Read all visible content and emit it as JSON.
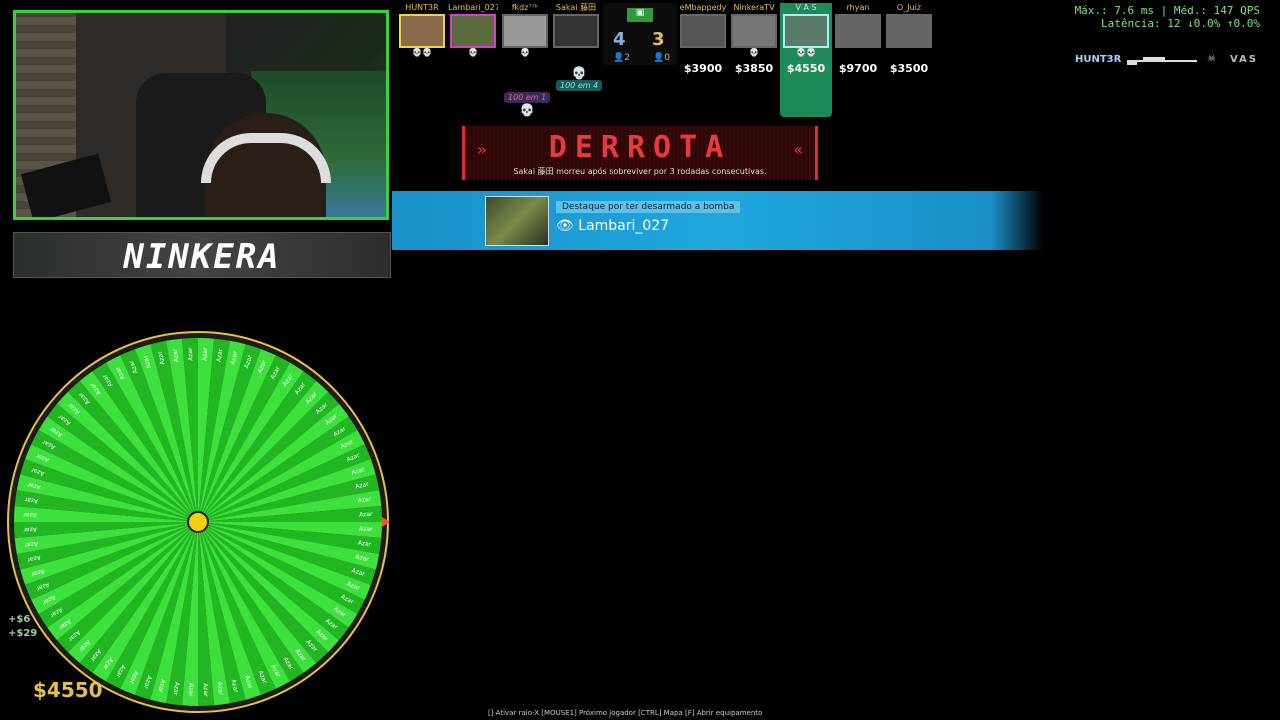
{
  "stats": {
    "line1": "Máx.: 7.6 ms | Méd.: 147 QPS",
    "line2": "Latência: 12 ↓0.0% ↑0.0%"
  },
  "killfeed": {
    "killer": "HUNT3R",
    "victim": "VAS"
  },
  "team_left": [
    {
      "name": "HUNT3R"
    },
    {
      "name": "Lambari_027"
    },
    {
      "name": "fkdz⁷⁷ᵏ"
    },
    {
      "name": "Sakai 藤田"
    }
  ],
  "team_right": [
    {
      "name": "eMbappedy",
      "money": "$3900"
    },
    {
      "name": "NinkeraTV",
      "money": "$3850"
    },
    {
      "name": "V A S",
      "money": "$4550"
    },
    {
      "name": "rhyan",
      "money": "$9700"
    },
    {
      "name": "O_Juiz",
      "money": "$3500"
    }
  ],
  "score": {
    "left": "4",
    "right": "3",
    "left_alive": "2",
    "right_alive": "0"
  },
  "badges": {
    "a": "100 em 4",
    "b": "100 em 1"
  },
  "round": {
    "title": "DERROTA",
    "subtitle": "Sakai 藤田 morreu após sobreviver por 3 rodadas consecutivas."
  },
  "mvp": {
    "label": "Destaque por ter desarmado a bomba",
    "player": "Lambari_027"
  },
  "streamer": "NINKERA",
  "wheel_label": "Azar",
  "money": "$4550",
  "side_money": [
    "+$6",
    "+$29"
  ],
  "keys": "[] Ativar raio-X   [MOUSE1] Próximo jogador   [CTRL] Mapa   [F] Abrir equipamento",
  "colors": {
    "accent_green": "#3ad13a",
    "loss_red": "#e83a3a",
    "mvp_blue": "#1fa8de"
  }
}
